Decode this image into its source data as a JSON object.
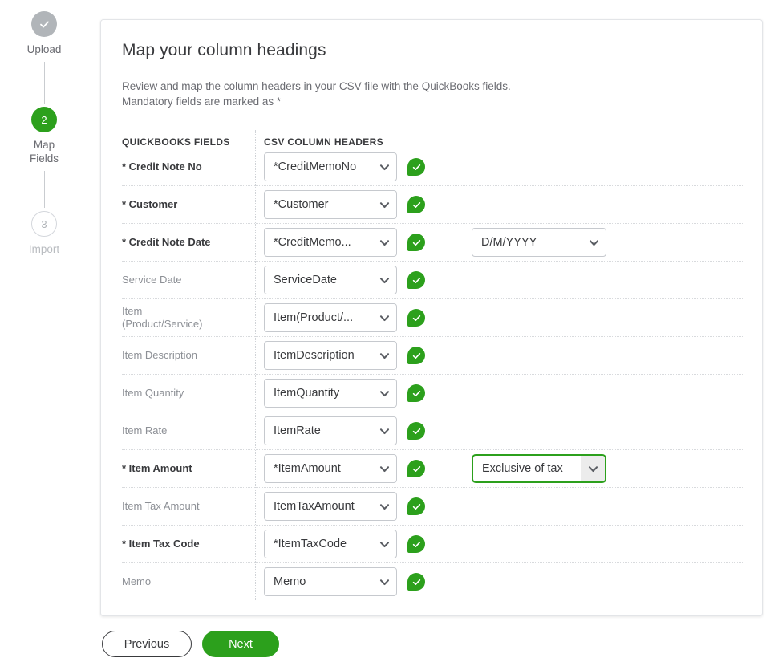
{
  "stepper": {
    "steps": [
      {
        "marker": "check",
        "label": "Upload",
        "state": "done"
      },
      {
        "marker": "2",
        "label": "Map\nFields",
        "label_line1": "Map",
        "label_line2": "Fields",
        "state": "current"
      },
      {
        "marker": "3",
        "label": "Import",
        "state": "todo"
      }
    ]
  },
  "card": {
    "title": "Map your column headings",
    "intro_line1": "Review and map the column headers in your CSV file with the QuickBooks fields.",
    "intro_line2": "Mandatory fields are marked as *",
    "table": {
      "header_qb": "QUICKBOOKS FIELDS",
      "header_csv": "CSV COLUMN HEADERS",
      "rows": [
        {
          "label": "* Credit Note No",
          "required": true,
          "csv_value": "*CreditMemoNo",
          "status": "valid"
        },
        {
          "label": "* Customer",
          "required": true,
          "csv_value": "*Customer",
          "status": "valid"
        },
        {
          "label": "* Credit Note Date",
          "required": true,
          "csv_value": "*CreditMemo...",
          "status": "valid",
          "extra_value": "D/M/YYYY",
          "extra_focused": false
        },
        {
          "label": "Service Date",
          "required": false,
          "csv_value": "ServiceDate",
          "status": "valid"
        },
        {
          "label_line1": "Item",
          "label_line2": "(Product/Service)",
          "label": "Item (Product/Service)",
          "required": false,
          "csv_value": "Item(Product/...",
          "status": "valid"
        },
        {
          "label": "Item Description",
          "required": false,
          "csv_value": "ItemDescription",
          "status": "valid"
        },
        {
          "label": "Item Quantity",
          "required": false,
          "csv_value": "ItemQuantity",
          "status": "valid"
        },
        {
          "label": "Item Rate",
          "required": false,
          "csv_value": "ItemRate",
          "status": "valid"
        },
        {
          "label": "* Item Amount",
          "required": true,
          "csv_value": "*ItemAmount",
          "status": "valid",
          "extra_value": "Exclusive of tax",
          "extra_focused": true
        },
        {
          "label": "Item Tax Amount",
          "required": false,
          "csv_value": "ItemTaxAmount",
          "status": "valid"
        },
        {
          "label": "* Item Tax Code",
          "required": true,
          "csv_value": "*ItemTaxCode",
          "status": "valid"
        },
        {
          "label": "Memo",
          "required": false,
          "csv_value": "Memo",
          "status": "valid"
        }
      ]
    }
  },
  "footer": {
    "previous_label": "Previous",
    "next_label": "Next"
  },
  "colors": {
    "brand_green": "#2ca01c",
    "text_dark": "#393a3d",
    "text_muted": "#8d9096",
    "border": "#c6c9ce"
  }
}
